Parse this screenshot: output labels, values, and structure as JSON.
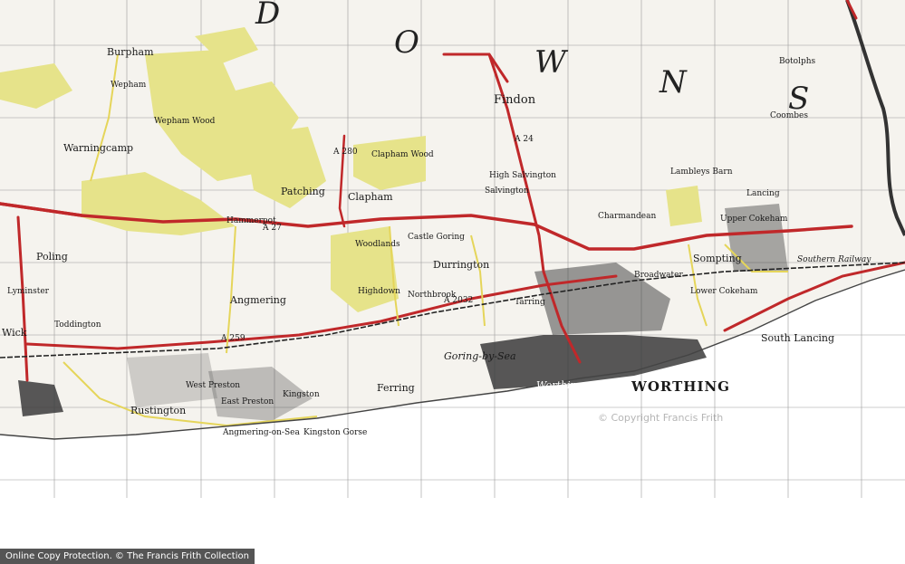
{
  "map": {
    "large_letters": [
      "D",
      "O",
      "W",
      "N",
      "S"
    ],
    "towns": [
      "WORTHING",
      "Worthing"
    ],
    "places": [
      "Burpham",
      "Wepham",
      "Warningcamp",
      "Poling",
      "Angmering",
      "Wick",
      "Rustington",
      "East Preston",
      "West Preston",
      "Kingston",
      "Ferring",
      "Goring-by-Sea",
      "Durrington",
      "Findon",
      "Clapham",
      "Patching",
      "Hammerpot",
      "Sompting",
      "Lancing",
      "South Lancing",
      "Broadwater",
      "Salvington",
      "Highdown",
      "Northbrook",
      "Toddington",
      "Lower Cokeham",
      "Coombes",
      "Botolphs",
      "Clapham Wood",
      "Wepham Wood",
      "Angmering-on-Sea",
      "Kingston Gorse",
      "High Salvington",
      "Southern Railway",
      "Tarring",
      "Charmandean",
      "Upper Cokeham",
      "Lyminster",
      "Woodlands",
      "Castle Goring",
      "Lambleys Barn"
    ],
    "road_numbers": [
      "A 27",
      "A 259",
      "A 2032",
      "A 280",
      "A 24"
    ],
    "colors": {
      "woodland": "#e6e38a",
      "road": "#c0282a",
      "secondary": "#e5d55a",
      "urban": "#2c2c2c",
      "sea": "#ffffff"
    }
  },
  "watermark": "© Copyright Francis Frith",
  "footer": "Online Copy Protection.  © The Francis Frith Collection"
}
